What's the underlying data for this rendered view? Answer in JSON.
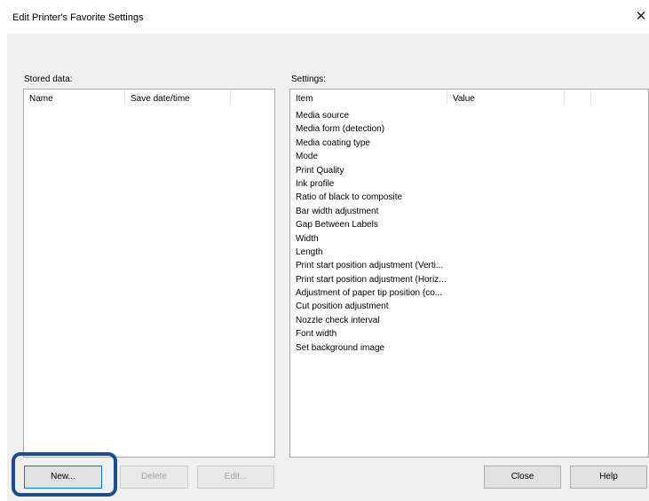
{
  "window": {
    "title": "Edit Printer's Favorite Settings",
    "close_glyph": "✕"
  },
  "stored": {
    "label": "Stored data:",
    "columns": [
      "Name",
      "Save date/time"
    ]
  },
  "settings": {
    "label": "Settings:",
    "columns": [
      "Item",
      "Value"
    ],
    "items": [
      "Media source",
      "Media form (detection)",
      "Media coating type",
      "Mode",
      "Print Quality",
      "Ink profile",
      "Ratio of black to composite",
      "Bar width adjustment",
      "Gap Between Labels",
      "Width",
      "Length",
      "Print start position adjustment (Verti...",
      "Print start position adjustment (Horiz...",
      "Adjustment of paper tip position (co...",
      "Cut position adjustment",
      "Nozzle check interval",
      "Font width",
      "Set background image"
    ]
  },
  "buttons": {
    "new": "New...",
    "delete": "Delete",
    "edit": "Edit...",
    "close": "Close",
    "help": "Help"
  },
  "colors": {
    "highlight": "#1c4e8c",
    "focus_border": "#0078d7",
    "dialog_bg": "#f0f0f0"
  }
}
